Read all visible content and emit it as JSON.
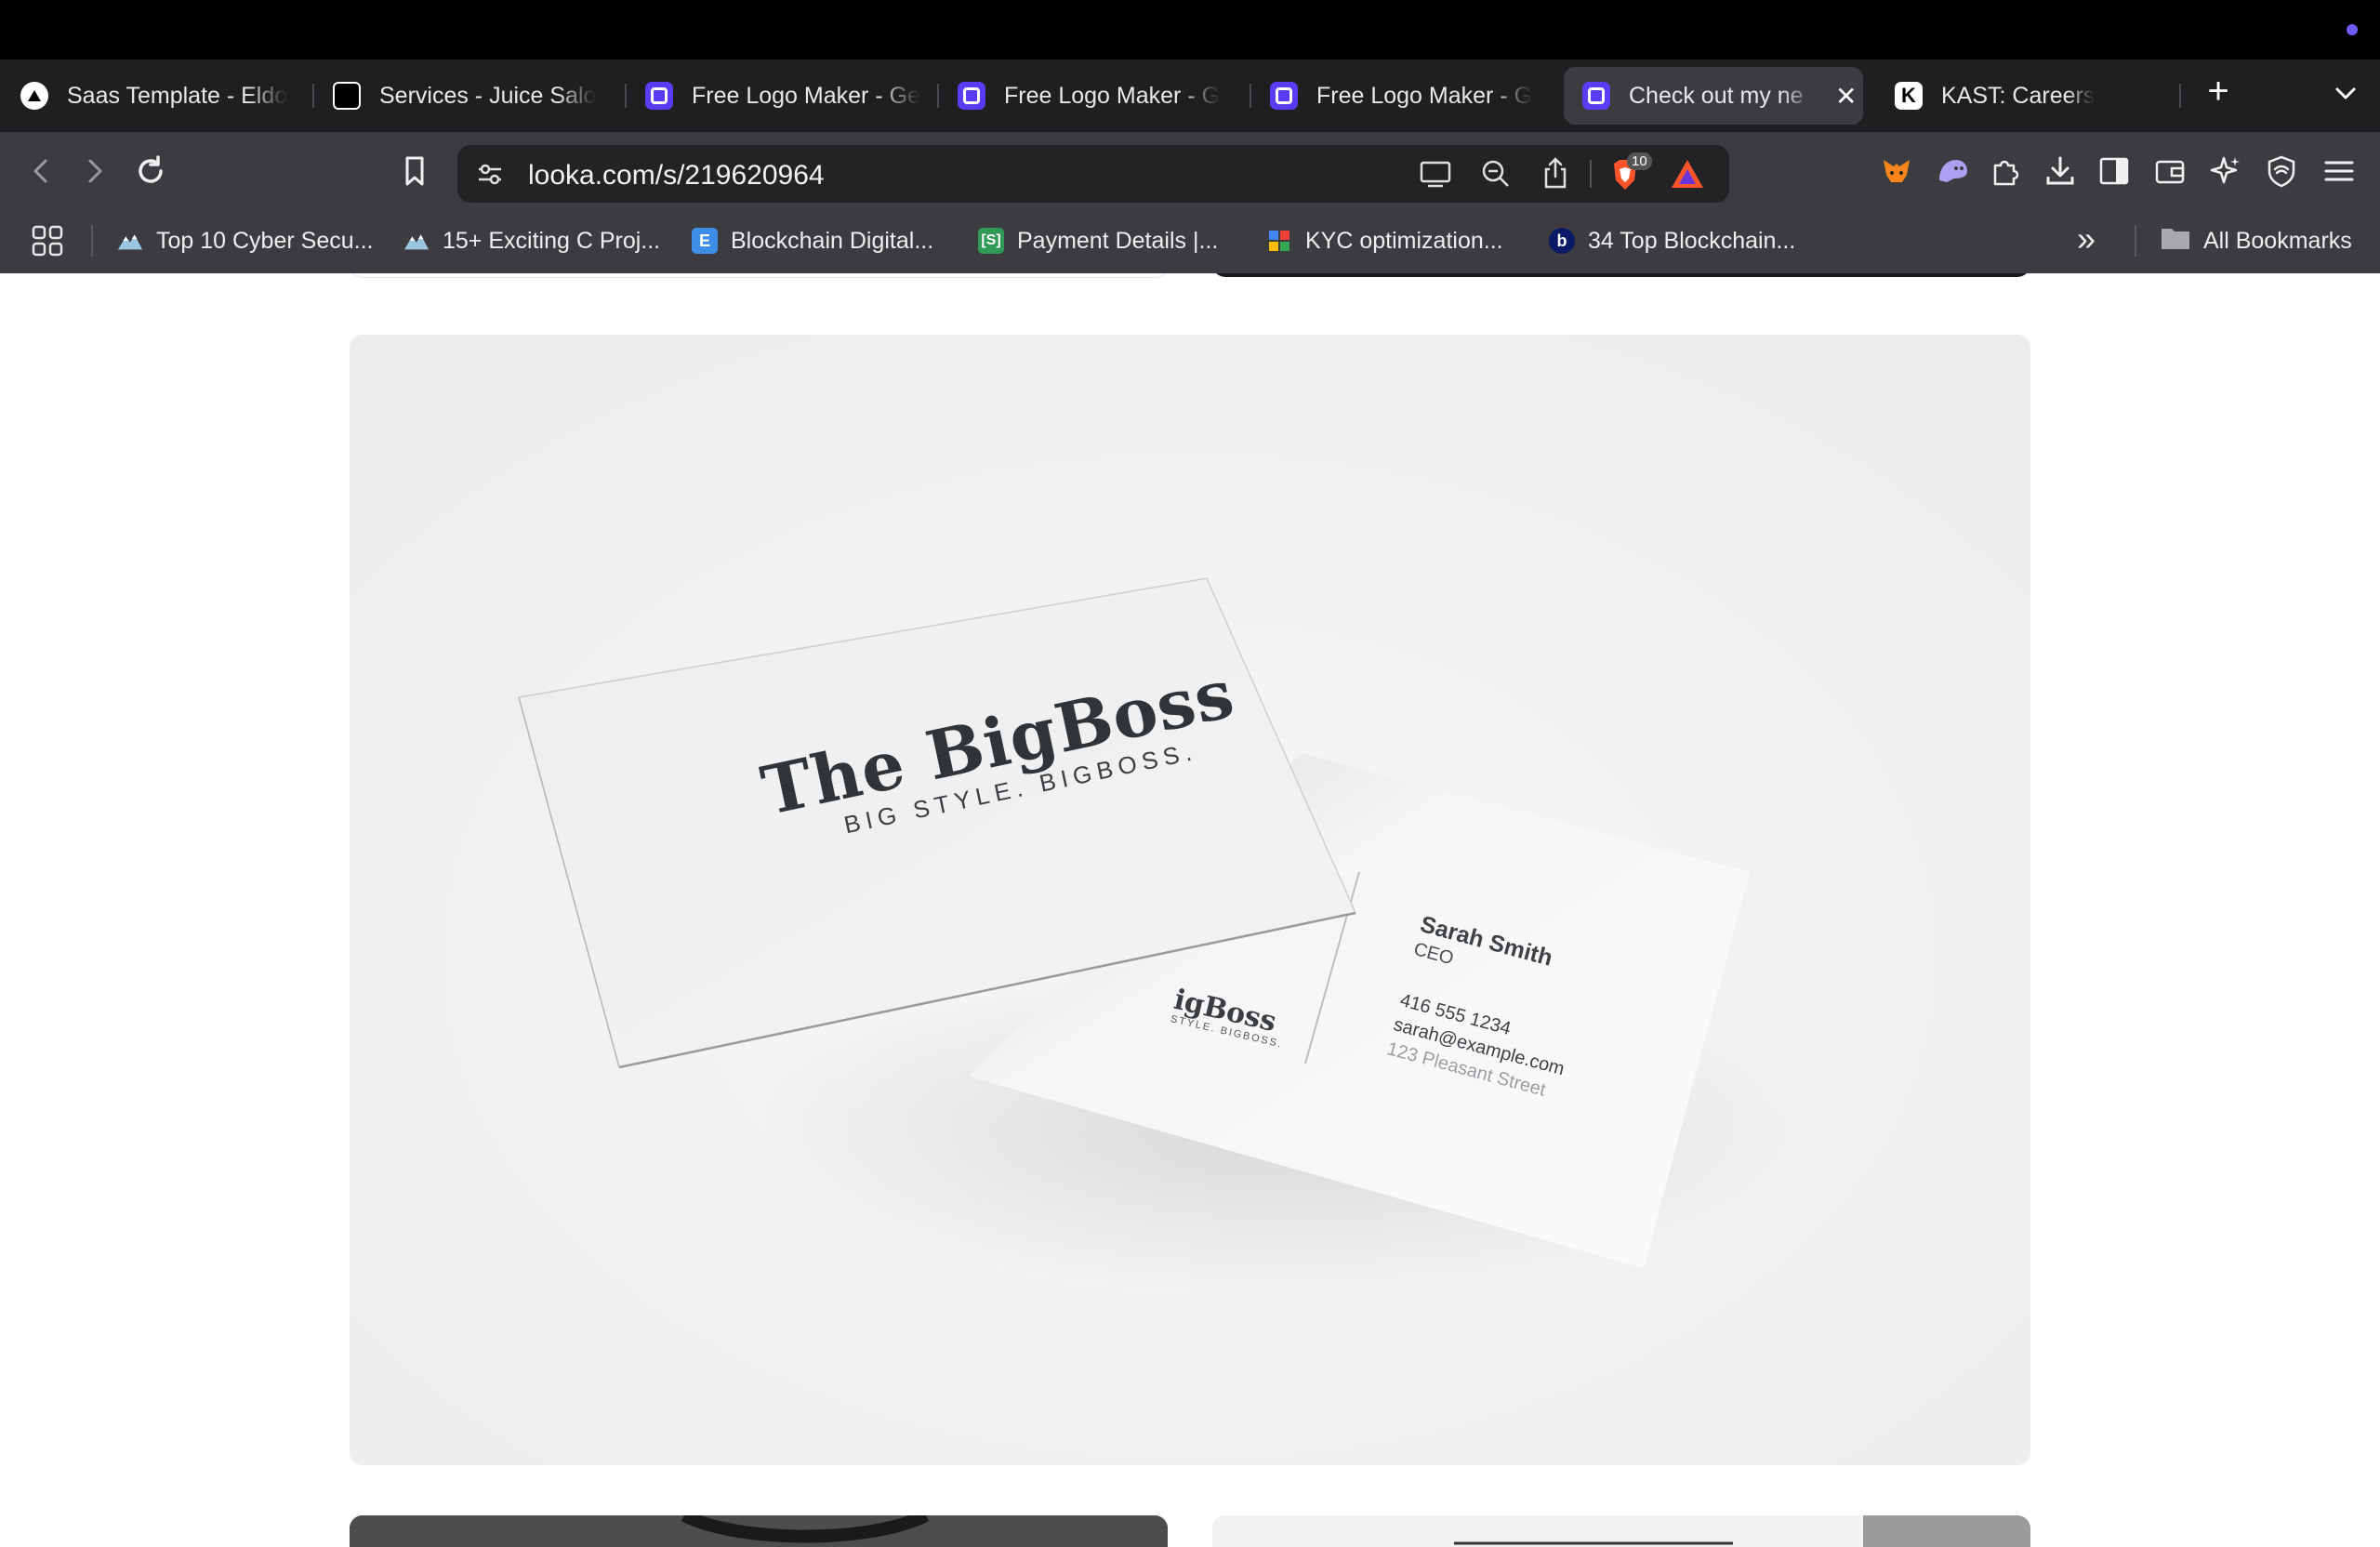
{
  "browser": {
    "tabs": [
      {
        "label": "Saas Template - Eldo",
        "icon": "saas-icon"
      },
      {
        "label": "Services - Juice Salo",
        "icon": "juice-icon"
      },
      {
        "label": "Free Logo Maker - Ge",
        "icon": "looka-icon"
      },
      {
        "label": "Free Logo Maker - G",
        "icon": "looka-icon"
      },
      {
        "label": "Free Logo Maker - G",
        "icon": "looka-icon"
      },
      {
        "label": "Check out my ne",
        "icon": "looka-icon",
        "active": true
      },
      {
        "label": "KAST: Careers",
        "icon": "kast-icon"
      }
    ],
    "close_glyph": "✕",
    "new_tab_glyph": "+",
    "url": "looka.com/s/219620964",
    "shields_count": "10",
    "bookmarks": [
      {
        "label": "Top 10 Cyber Secu..."
      },
      {
        "label": "15+ Exciting C Proj..."
      },
      {
        "label": "Blockchain Digital...",
        "badge": "E"
      },
      {
        "label": "Payment Details |...",
        "badge": "[S]"
      },
      {
        "label": "KYC optimization..."
      },
      {
        "label": "34 Top Blockchain...",
        "badge": "b"
      }
    ],
    "more_bookmarks": "»",
    "all_bookmarks": "All Bookmarks"
  },
  "mockup": {
    "front_card": {
      "brand": "The BigBoss",
      "tagline": "BIG STYLE. BIGBOSS."
    },
    "back_card": {
      "brand_partial": "BigBoss",
      "tagline_partial": "STYLE. BIGBOSS.",
      "name": "Sarah Smith",
      "title": "CEO",
      "phone": "416 555 1234",
      "email": "sarah@example.com",
      "address": "123 Pleasant Street"
    }
  },
  "colors": {
    "accent": "#5a3cf5",
    "chrome": "#3c3c40",
    "tabbar": "#1f1f21"
  }
}
